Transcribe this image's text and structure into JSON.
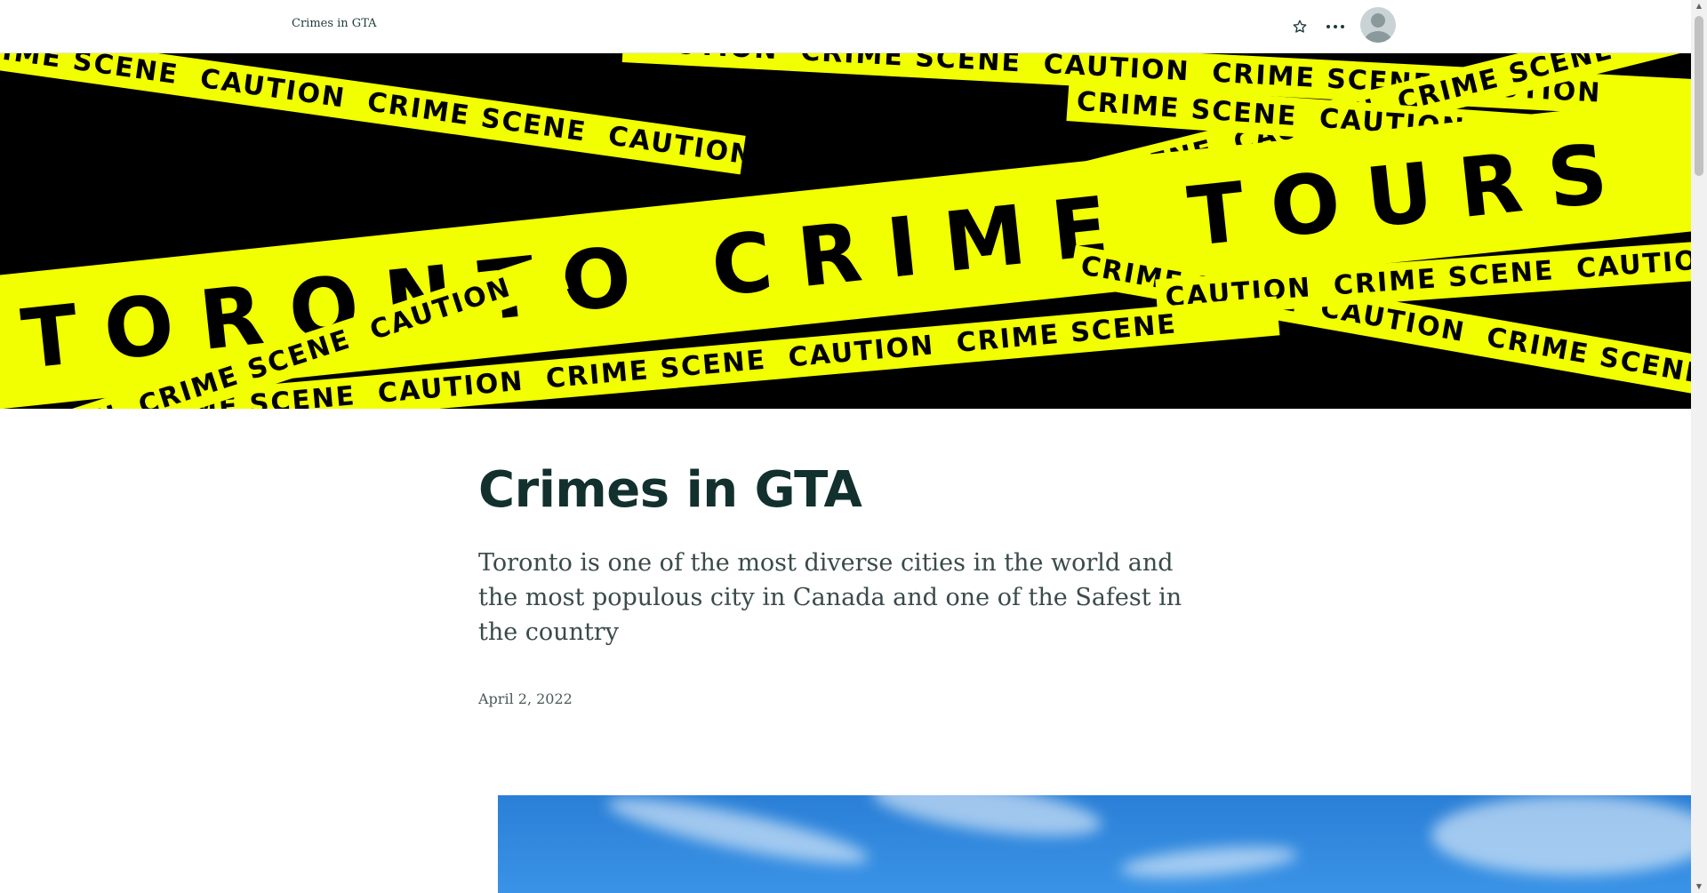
{
  "header": {
    "site_title": "Crimes in GTA",
    "icons": [
      "star-icon",
      "more-icon",
      "user-avatar-icon"
    ]
  },
  "hero": {
    "tape_word_1": "CRIME SCENE",
    "tape_word_2": "CAUTION",
    "banner_title": "TORONTO CRIME TOURS",
    "tape_color": "#f2ff00",
    "background_color": "#000000"
  },
  "article": {
    "title": "Crimes in GTA",
    "summary": "Toronto is one of the most diverse cities in the world and the most populous city in Canada and one of the Safest in the country",
    "date": "April 2, 2022"
  },
  "colors": {
    "heading": "#12302e",
    "body_text": "#3a4a4a",
    "sky": "#2a7fd6"
  }
}
